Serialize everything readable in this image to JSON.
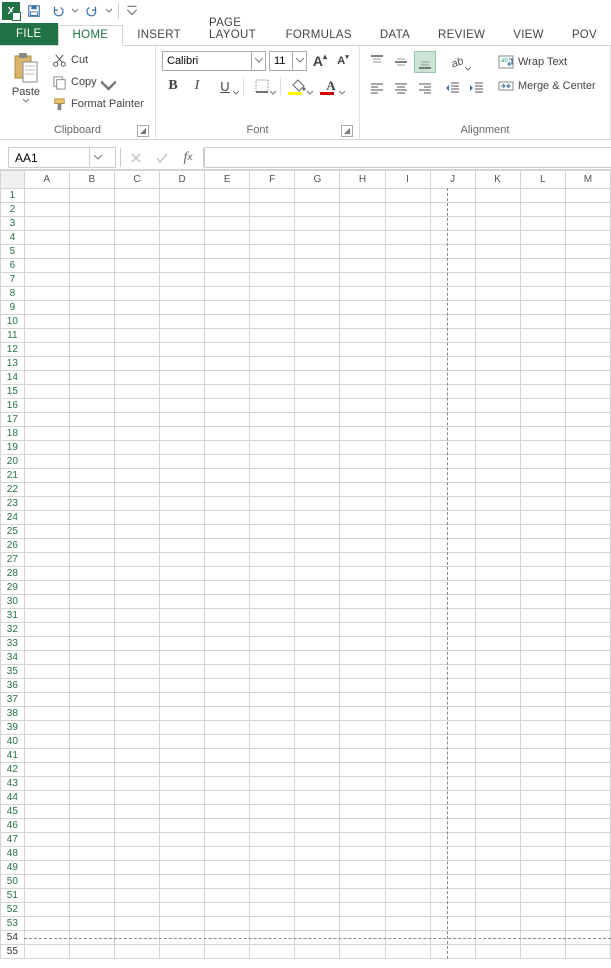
{
  "qat": {
    "icons": [
      "excel",
      "save",
      "undo",
      "redo",
      "divider",
      "customize"
    ]
  },
  "tabs": {
    "file": "FILE",
    "items": [
      "HOME",
      "INSERT",
      "PAGE LAYOUT",
      "FORMULAS",
      "DATA",
      "REVIEW",
      "VIEW",
      "POV"
    ],
    "active": "HOME"
  },
  "ribbon": {
    "clipboard": {
      "label": "Clipboard",
      "paste": "Paste",
      "cut": "Cut",
      "copy": "Copy",
      "format_painter": "Format Painter"
    },
    "font": {
      "label": "Font",
      "name": "Calibri",
      "size": "11",
      "grow": "A",
      "shrink": "A",
      "bold": "B",
      "italic": "I",
      "underline": "U"
    },
    "alignment": {
      "label": "Alignment",
      "wrap": "Wrap Text",
      "merge": "Merge & Center"
    }
  },
  "formula_bar": {
    "name_box": "AA1",
    "formula": ""
  },
  "grid": {
    "columns": [
      "A",
      "B",
      "C",
      "D",
      "E",
      "F",
      "G",
      "H",
      "I",
      "J",
      "K",
      "L",
      "M"
    ],
    "rows": [
      1,
      2,
      3,
      4,
      5,
      6,
      7,
      8,
      9,
      10,
      11,
      12,
      13,
      14,
      15,
      16,
      17,
      18,
      19,
      20,
      21,
      22,
      23,
      24,
      25,
      26,
      27,
      28,
      29,
      30,
      31,
      32,
      33,
      34,
      35,
      36,
      37,
      38,
      39,
      40,
      41,
      42,
      43,
      44,
      45,
      46,
      47,
      48,
      49,
      50,
      51,
      52,
      53,
      54,
      55
    ],
    "page_break_after_col": "I",
    "page_break_after_row": 50,
    "scrolled_rows_start": 54
  }
}
